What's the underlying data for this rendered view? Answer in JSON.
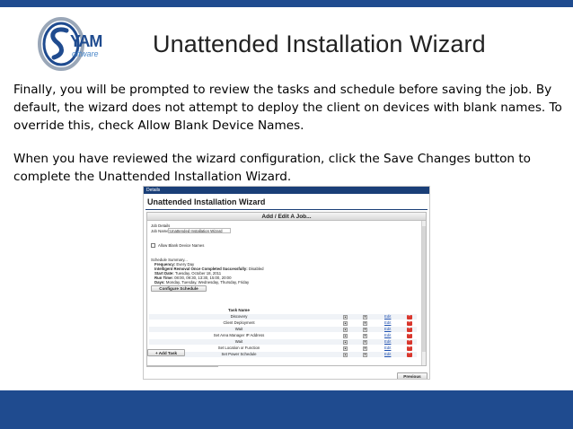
{
  "slide": {
    "title": "Unattended Installation Wizard",
    "paragraph1": "Finally, you will be prompted to review the tasks and schedule before saving the job. By default, the wizard does not attempt to deploy the client on devices with blank names. To override this, check Allow Blank Device Names.",
    "paragraph2": "When you have reviewed the wizard configuration, click the Save Changes button to complete the Unattended Installation Wizard."
  },
  "logo": {
    "text_main": "SYAM",
    "text_sub": "software",
    "accent": "#1f4b8f"
  },
  "colors": {
    "band": "#1f4b8f",
    "delete": "#d9362c",
    "link": "#1d4fb0"
  },
  "screenshot": {
    "header": "Details",
    "title": "Unattended Installation Wizard",
    "dialog_title": "Add / Edit A Job...",
    "job_details_label": "Job Details",
    "job_name_label": "Job Name:",
    "job_name_value": "Unattended Installation Wizard",
    "allow_blank_label": "Allow Blank Device Names",
    "allow_blank_checked": false,
    "schedule_summary_label": "Schedule Summary...",
    "schedule": {
      "frequency_label": "Frequency:",
      "frequency_value": "Every Day",
      "removal_label": "Intelligent Removal Once Completed Successfully:",
      "removal_value": "Disabled",
      "start_label": "Start Date:",
      "start_value": "Tuesday, October 18, 2011",
      "runtime_label": "Run Time:",
      "runtime_value": "08:00, 09:30, 13:30, 15:00, 20:00",
      "days_label": "Days:",
      "days_value": "Monday, Tuesday, Wednesday, Thursday, Friday"
    },
    "configure_schedule_button": "Configure Schedule",
    "task_name_header": "Task Name",
    "tasks": [
      {
        "name": "Discovery",
        "edit": "Edit"
      },
      {
        "name": "Client Deployment",
        "edit": "Edit"
      },
      {
        "name": "Wait",
        "edit": "Edit"
      },
      {
        "name": "Set Area Manager IP Address",
        "edit": "Edit"
      },
      {
        "name": "Wait",
        "edit": "Edit"
      },
      {
        "name": "Set Location or Function",
        "edit": "Edit"
      },
      {
        "name": "Set Power Schedule",
        "edit": "Edit"
      }
    ],
    "add_task_button": "+ Add Task",
    "previous_button": "Previous"
  }
}
